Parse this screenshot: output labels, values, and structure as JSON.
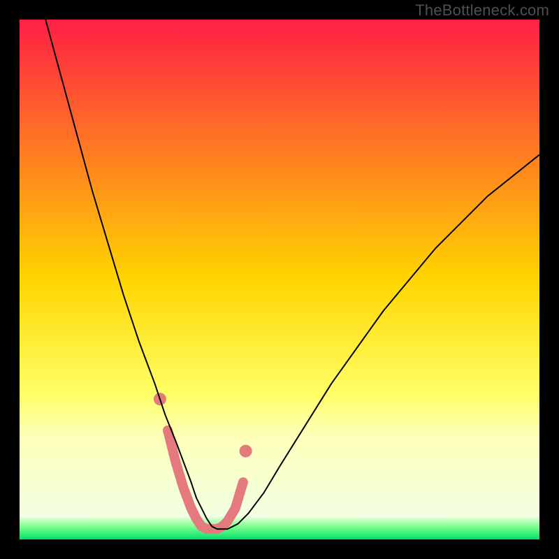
{
  "watermark": "TheBottleneck.com",
  "chart_data": {
    "type": "line",
    "title": "",
    "xlabel": "",
    "ylabel": "",
    "xlim": [
      0,
      100
    ],
    "ylim": [
      0,
      100
    ],
    "grid": false,
    "legend": false,
    "background_gradient": {
      "stops": [
        {
          "pos": 0.0,
          "color": "#ff1f45"
        },
        {
          "pos": 0.5,
          "color": "#ffd500"
        },
        {
          "pos": 0.72,
          "color": "#ffff66"
        },
        {
          "pos": 0.8,
          "color": "#fdffb9"
        },
        {
          "pos": 0.955,
          "color": "#f2ffe2"
        },
        {
          "pos": 0.975,
          "color": "#7fff8f"
        },
        {
          "pos": 1.0,
          "color": "#00e06a"
        }
      ]
    },
    "series": [
      {
        "name": "bottleneck-curve",
        "kind": "line",
        "color": "#000000",
        "width": 2,
        "x": [
          5,
          8,
          11,
          14,
          17,
          20,
          23,
          26,
          28,
          30,
          31.5,
          33,
          34,
          35,
          36,
          37,
          38,
          40,
          42,
          44,
          47,
          50,
          55,
          60,
          65,
          70,
          75,
          80,
          85,
          90,
          95,
          100
        ],
        "y": [
          100,
          89,
          78,
          67,
          57,
          47,
          38,
          30,
          24,
          19,
          15,
          11,
          8,
          6,
          4,
          2.5,
          2,
          2,
          3,
          5,
          9,
          14,
          22,
          30,
          37,
          44,
          50,
          56,
          61,
          66,
          70,
          74
        ]
      },
      {
        "name": "highlight-band",
        "kind": "line",
        "color": "#e47a7d",
        "width": 14,
        "linecap": "round",
        "x": [
          28.5,
          30,
          31.5,
          33,
          34,
          35,
          36,
          37,
          38,
          39,
          40,
          41.5,
          43
        ],
        "y": [
          21,
          15,
          10,
          6,
          4,
          2.5,
          2,
          2,
          2,
          2.5,
          3.5,
          6,
          11
        ]
      },
      {
        "name": "highlight-endpoints",
        "kind": "scatter",
        "color": "#e47a7d",
        "radius": 9,
        "x": [
          27,
          43.5
        ],
        "y": [
          27,
          17
        ]
      }
    ]
  }
}
